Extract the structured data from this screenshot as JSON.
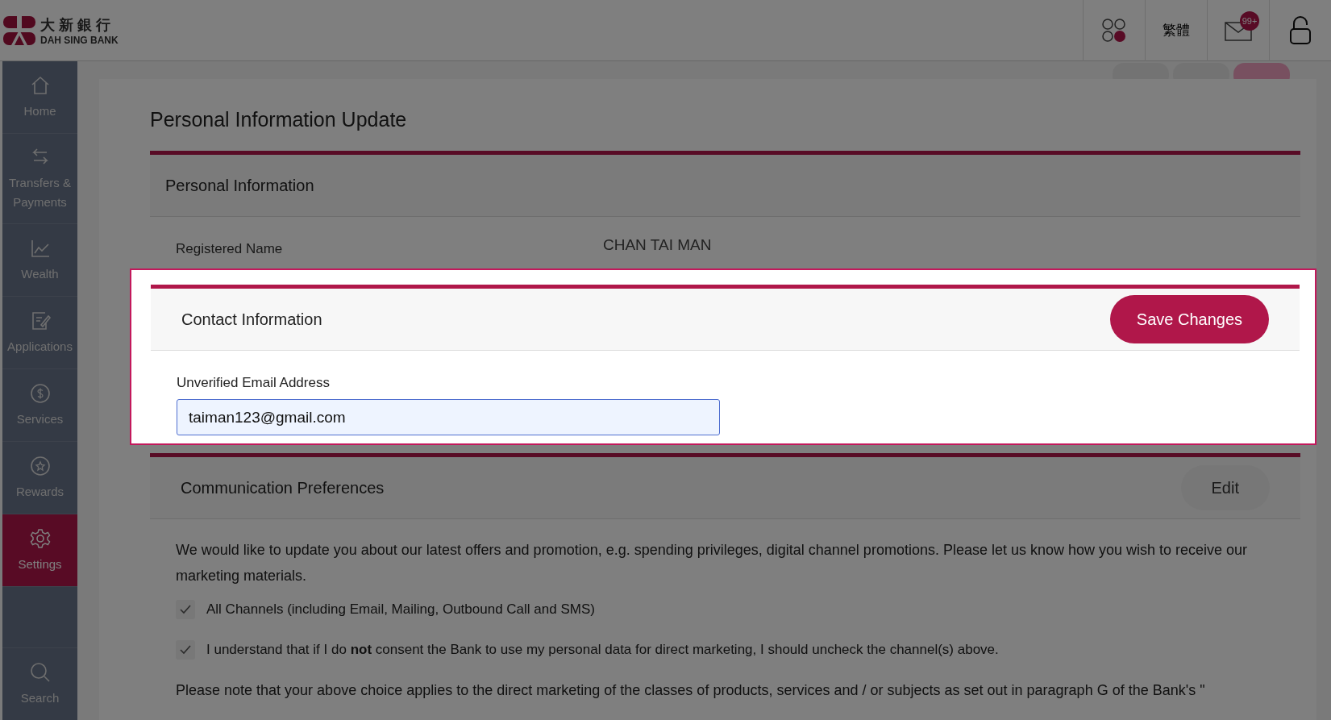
{
  "header": {
    "logo_chinese": "大新銀行",
    "logo_english": "DAH SING BANK",
    "language": "繁體",
    "mail_badge": "99+"
  },
  "sidebar": {
    "items": [
      {
        "label": "Home",
        "selected": false
      },
      {
        "label": "Transfers & Payments",
        "selected": false
      },
      {
        "label": "Wealth",
        "selected": false
      },
      {
        "label": "Applications",
        "selected": false
      },
      {
        "label": "Services",
        "selected": false
      },
      {
        "label": "Rewards",
        "selected": false
      },
      {
        "label": "Settings",
        "selected": true
      }
    ],
    "search": "Search"
  },
  "page": {
    "title": "Personal Information Update",
    "tabs": [
      {
        "selected": false
      },
      {
        "selected": false
      },
      {
        "selected": true
      }
    ],
    "personal": {
      "heading": "Personal Information",
      "field_label": "Registered Name",
      "field_value": "CHAN TAI MAN"
    },
    "contact": {
      "heading": "Contact Information",
      "button": "Save Changes",
      "field_label": "Unverified Email Address",
      "email": "taiman123@gmail.com",
      "highlighted": true
    },
    "preferences": {
      "heading": "Communication Preferences",
      "button": "Edit",
      "intro": "We would like to update you about our latest offers and promotion, e.g. spending privileges, digital channel promotions. Please let us know how you wish to receive our marketing materials.",
      "options": [
        {
          "label": "All Channels (including Email, Mailing, Outbound Call and SMS)",
          "checked": true
        },
        {
          "label": "I understand that if I do **not** consent the Bank to use my personal data for direct marketing, I should uncheck the channel(s) above.",
          "checked": true
        }
      ],
      "note": "Please note that your above choice applies to the direct marketing of the classes of products, services and / or subjects as set out in paragraph G of the Bank's \""
    }
  }
}
